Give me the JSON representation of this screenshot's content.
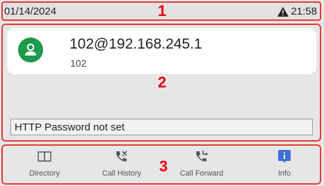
{
  "status_bar": {
    "date": "01/14/2024",
    "time": "21:58",
    "warning_icon": "warning-triangle-icon",
    "region_number": "1"
  },
  "main": {
    "region_number": "2",
    "account": {
      "address": "102@192.168.245.1",
      "extension": "102",
      "avatar_icon": "user-icon",
      "avatar_color": "#1b9b4b"
    },
    "notice": "HTTP Password not set"
  },
  "softkeys": {
    "region_number": "3",
    "items": [
      {
        "label": "Directory",
        "icon": "book-icon"
      },
      {
        "label": "Call History",
        "icon": "call-history-icon"
      },
      {
        "label": "Call Forward",
        "icon": "call-forward-icon"
      },
      {
        "label": "Info",
        "icon": "info-icon",
        "color": "#3f6fd8"
      }
    ]
  },
  "colors": {
    "annotation_red": "#e3000f",
    "icon_green": "#1b9b4b"
  }
}
